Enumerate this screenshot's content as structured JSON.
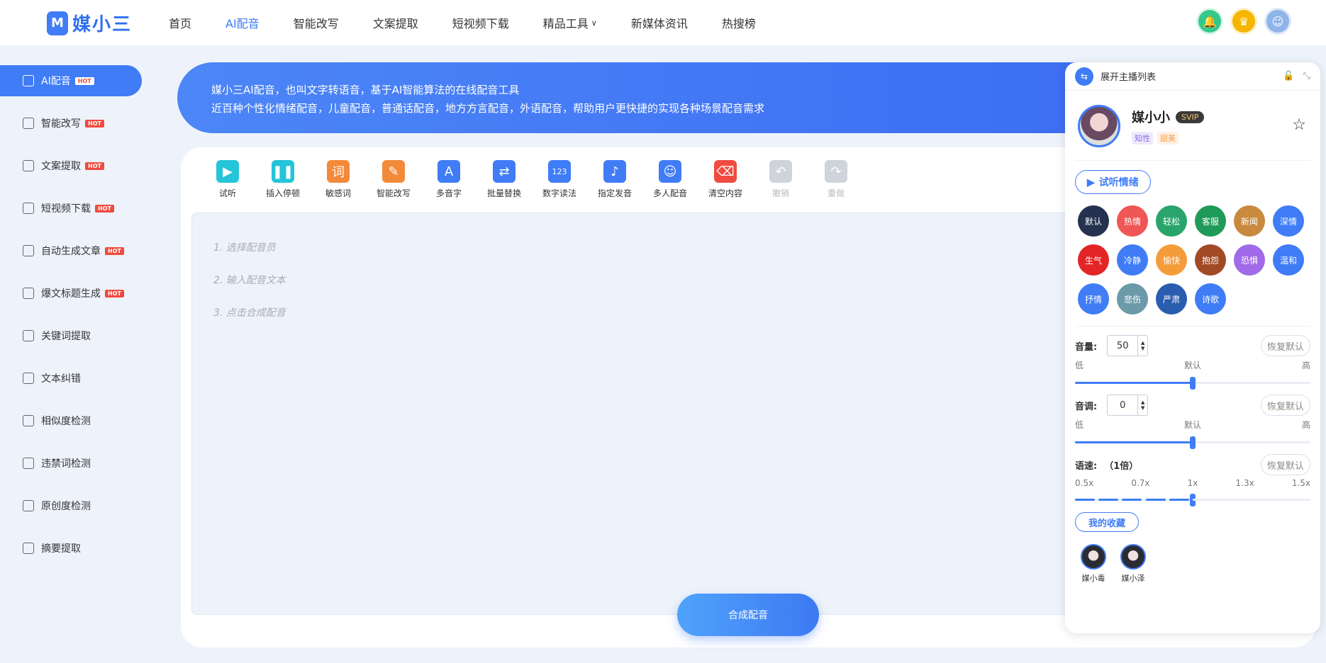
{
  "brand": {
    "name": "媒小三",
    "mark": "M"
  },
  "nav": {
    "items": [
      {
        "label": "首页",
        "active": false
      },
      {
        "label": "AI配音",
        "active": true
      },
      {
        "label": "智能改写",
        "active": false
      },
      {
        "label": "文案提取",
        "active": false
      },
      {
        "label": "短视频下载",
        "active": false
      },
      {
        "label": "精品工具",
        "active": false,
        "dropdown": true
      },
      {
        "label": "新媒体资讯",
        "active": false
      },
      {
        "label": "热搜榜",
        "active": false
      }
    ],
    "dropdown_glyph": "∨"
  },
  "sidebar": {
    "hot_label": "HOT",
    "items": [
      {
        "label": "AI配音",
        "hot": true,
        "active": true,
        "icon": "waveform-icon"
      },
      {
        "label": "智能改写",
        "hot": true,
        "active": false,
        "icon": "edit-icon"
      },
      {
        "label": "文案提取",
        "hot": true,
        "active": false,
        "icon": "play-icon"
      },
      {
        "label": "短视频下载",
        "hot": true,
        "active": false,
        "icon": "cloud-download-icon"
      },
      {
        "label": "自动生成文章",
        "hot": true,
        "active": false,
        "icon": "text-icon"
      },
      {
        "label": "爆文标题生成",
        "hot": true,
        "active": false,
        "icon": "title-icon"
      },
      {
        "label": "关键词提取",
        "hot": false,
        "active": false,
        "icon": "target-icon"
      },
      {
        "label": "文本纠错",
        "hot": false,
        "active": false,
        "icon": "bug-icon"
      },
      {
        "label": "相似度检测",
        "hot": false,
        "active": false,
        "icon": "magnify-icon"
      },
      {
        "label": "违禁词检测",
        "hot": false,
        "active": false,
        "icon": "document-icon"
      },
      {
        "label": "原创度检测",
        "hot": false,
        "active": false,
        "icon": "doc-check-icon"
      },
      {
        "label": "摘要提取",
        "hot": false,
        "active": false,
        "icon": "doc-search-icon"
      }
    ]
  },
  "banner": {
    "line1": "媒小三AI配音，也叫文字转语音，基于AI智能算法的在线配音工具",
    "line2": "近百种个性化情绪配音，儿童配音，普通话配音，地方方言配音，外语配音，帮助用户更快捷的实现各种场景配音需求"
  },
  "toolbar": {
    "tools": [
      {
        "label": "试听",
        "icon": "play-circle-icon",
        "glyph": "▶",
        "color": "#25c4d8",
        "disabled": false
      },
      {
        "label": "插入停顿",
        "icon": "pause-circle-icon",
        "glyph": "❚❚",
        "color": "#25c4d8",
        "disabled": false
      },
      {
        "label": "敏感词",
        "icon": "sensitive-word-icon",
        "glyph": "词",
        "color": "#f38a3a",
        "disabled": false
      },
      {
        "label": "智能改写",
        "icon": "pencil-icon",
        "glyph": "✎",
        "color": "#f38a3a",
        "disabled": false
      },
      {
        "label": "多音字",
        "icon": "polyphone-icon",
        "glyph": "A",
        "color": "#3f7cf6",
        "disabled": false
      },
      {
        "label": "批量替换",
        "icon": "replace-icon",
        "glyph": "⇄",
        "color": "#3f7cf6",
        "disabled": false
      },
      {
        "label": "数字读法",
        "icon": "number-icon",
        "glyph": "123",
        "color": "#3f7cf6",
        "disabled": false
      },
      {
        "label": "指定发音",
        "icon": "sound-icon",
        "glyph": "♪",
        "color": "#3f7cf6",
        "disabled": false
      },
      {
        "label": "多人配音",
        "icon": "users-icon",
        "glyph": "☺",
        "color": "#3f7cf6",
        "disabled": false
      },
      {
        "label": "清空内容",
        "icon": "broom-icon",
        "glyph": "⌫",
        "color": "#ef4b3f",
        "disabled": false
      },
      {
        "label": "撤销",
        "icon": "undo-icon",
        "glyph": "↶",
        "color": "#cfd3da",
        "disabled": true
      },
      {
        "label": "重做",
        "icon": "redo-icon",
        "glyph": "↷",
        "color": "#cfd3da",
        "disabled": true
      }
    ]
  },
  "editor": {
    "hints": [
      "1. 选择配音员",
      "2. 输入配音文本",
      "3. 点击合成配音"
    ]
  },
  "synth_button": "合成配音",
  "panel": {
    "header": "展开主播列表",
    "speaker": {
      "name": "媒小小",
      "badge": "SVIP",
      "tags": [
        "知性",
        "甜美"
      ]
    },
    "listen_label": "试听情绪",
    "emotions": [
      {
        "label": "默认",
        "color": "#24324f"
      },
      {
        "label": "热情",
        "color": "#ef5656"
      },
      {
        "label": "轻松",
        "color": "#29a56c"
      },
      {
        "label": "客服",
        "color": "#1f9a59"
      },
      {
        "label": "新闻",
        "color": "#c98a3f"
      },
      {
        "label": "深情",
        "color": "#3f7cf6"
      },
      {
        "label": "生气",
        "color": "#e42525"
      },
      {
        "label": "冷静",
        "color": "#3f7cf6"
      },
      {
        "label": "愉快",
        "color": "#f59c3a"
      },
      {
        "label": "抱怨",
        "color": "#a24a26"
      },
      {
        "label": "恐惧",
        "color": "#a06ae8"
      },
      {
        "label": "温和",
        "color": "#3f7cf6"
      },
      {
        "label": "抒情",
        "color": "#3f7cf6"
      },
      {
        "label": "悲伤",
        "color": "#6b9aa9"
      },
      {
        "label": "严肃",
        "color": "#2a5db0"
      },
      {
        "label": "诗歌",
        "color": "#3f7cf6"
      }
    ],
    "volume": {
      "label": "音量:",
      "value": "50",
      "reset": "恢复默认",
      "low": "低",
      "mid": "默认",
      "high": "高",
      "level": 0.5
    },
    "pitch": {
      "label": "音调:",
      "value": "0",
      "reset": "恢复默认",
      "low": "低",
      "mid": "默认",
      "high": "高",
      "level": 0.5
    },
    "speed": {
      "label": "语速:",
      "value": "（1倍）",
      "reset": "恢复默认",
      "ticks": [
        "0.5x",
        "0.7x",
        "1x",
        "1.3x",
        "1.5x"
      ],
      "level": 0.5
    },
    "favorites_label": "我的收藏",
    "favorites": [
      {
        "name": "媒小毒"
      },
      {
        "name": "媒小泽"
      }
    ]
  }
}
